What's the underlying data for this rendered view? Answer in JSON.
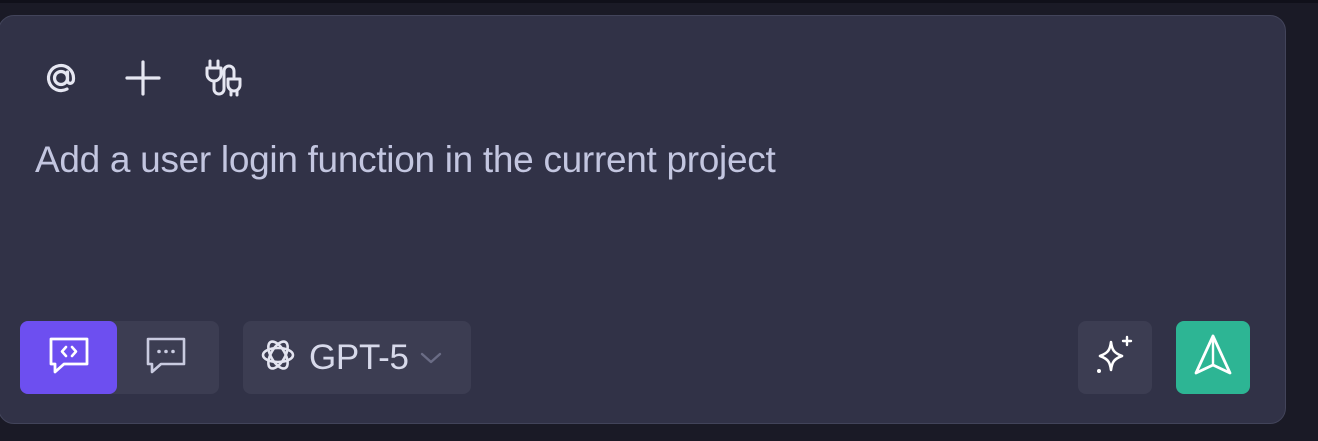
{
  "toolbar": {
    "icons": [
      "at-mention-icon",
      "plus-icon",
      "plugin-icon"
    ]
  },
  "prompt": {
    "value": "Add a user login function in the current project"
  },
  "mode_toggle": {
    "options": [
      "code-chat-icon",
      "chat-icon"
    ],
    "active_index": 0
  },
  "model": {
    "icon": "openai-icon",
    "name": "GPT-5"
  },
  "colors": {
    "panel_bg": "#313247",
    "active_accent": "#6d4ff0",
    "send_bg": "#2db594",
    "text": "#c3c6e0"
  }
}
